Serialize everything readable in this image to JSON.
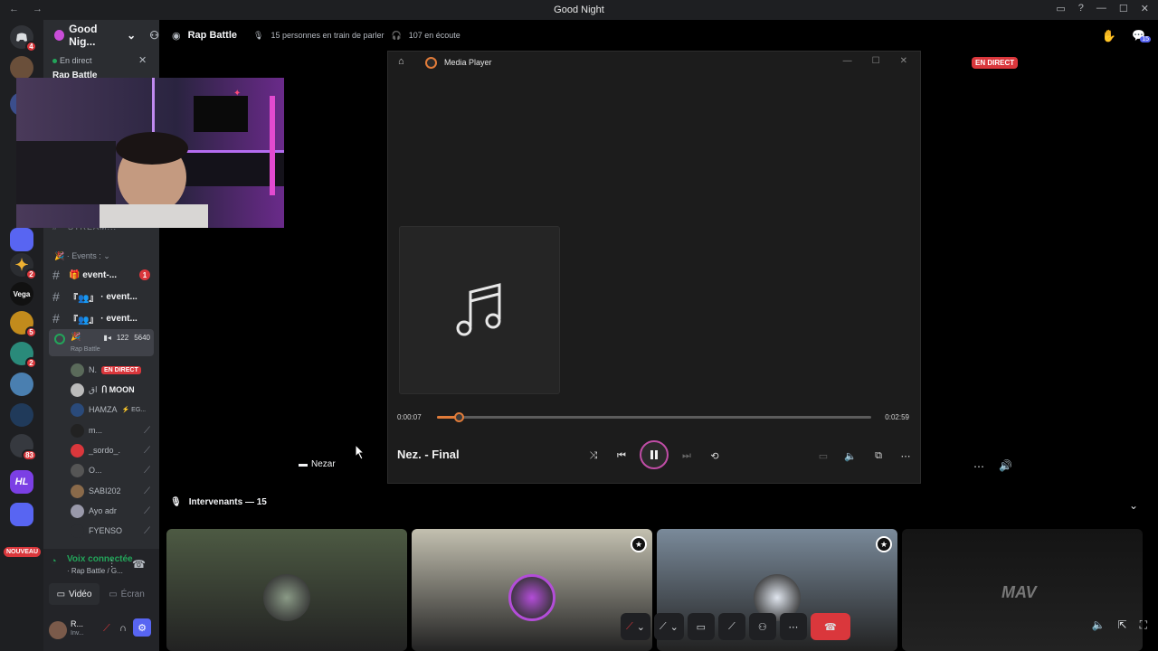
{
  "window": {
    "title": "Good Night",
    "nav": "← →"
  },
  "rail": {
    "badges": [
      "4",
      "2",
      "5",
      "2",
      "2",
      "83"
    ],
    "new_label": "NOUVEAU",
    "vega_label": "Vega"
  },
  "guild": {
    "name": "Good Nig...",
    "chevron": "⌄"
  },
  "sidebar": {
    "live_label": "En direct",
    "rap_battle_peek": "Rap Battle",
    "stream_peek": "#  · STREAM...",
    "category": "Events :",
    "channels": [
      {
        "name": "event-...",
        "unread": "1"
      },
      {
        "name": "· event..."
      },
      {
        "name": "· event..."
      }
    ],
    "voice_channel": {
      "cams": "122",
      "listeners": "5640",
      "name": "Rap Battle"
    },
    "voice_users": [
      {
        "name": "N.",
        "tag": "EN DIRECT"
      },
      {
        "name": "Ⴖ MOON",
        "prefix": "ﺍﻕ"
      },
      {
        "name": "HAMZA",
        "suffix": "⚡ EG..."
      },
      {
        "name": "m..."
      },
      {
        "name": "_sordo_."
      },
      {
        "name": "O..."
      },
      {
        "name": "SABI202"
      },
      {
        "name": "Ayo adr"
      },
      {
        "name": "FYENSO"
      }
    ]
  },
  "voice_panel": {
    "status": "Voix connectée",
    "channel": "· Rap Battle / G...",
    "video_label": "Vidéo",
    "screen_label": "Écran"
  },
  "user_panel": {
    "name": "R...",
    "status": "Inv..."
  },
  "channel_header": {
    "name": "Rap Battle",
    "speaking": "15 personnes en train de parler",
    "listening": "107 en écoute",
    "inbox_badge": "15"
  },
  "live_badge": "EN DIRECT",
  "media_player": {
    "app_title": "Media Player",
    "time_current": "0:00:07",
    "time_total": "0:02:59",
    "progress": 0.05,
    "song_title": "Nez. - Final",
    "accent": "#e07b39"
  },
  "stage": {
    "presenter": "Nezar",
    "speakers_label": "Intervenants — 15"
  },
  "tiles": [
    {
      "bg": "#4d5a43",
      "ring": "#8a9a86"
    },
    {
      "bg": "#c3c0b0",
      "ring": "#b34dd8",
      "moderator": true
    },
    {
      "bg": "#7a8a9a",
      "ring": "#e0e6ef",
      "moderator": true
    },
    {
      "bg": "#141414",
      "logo": "MAV"
    }
  ]
}
